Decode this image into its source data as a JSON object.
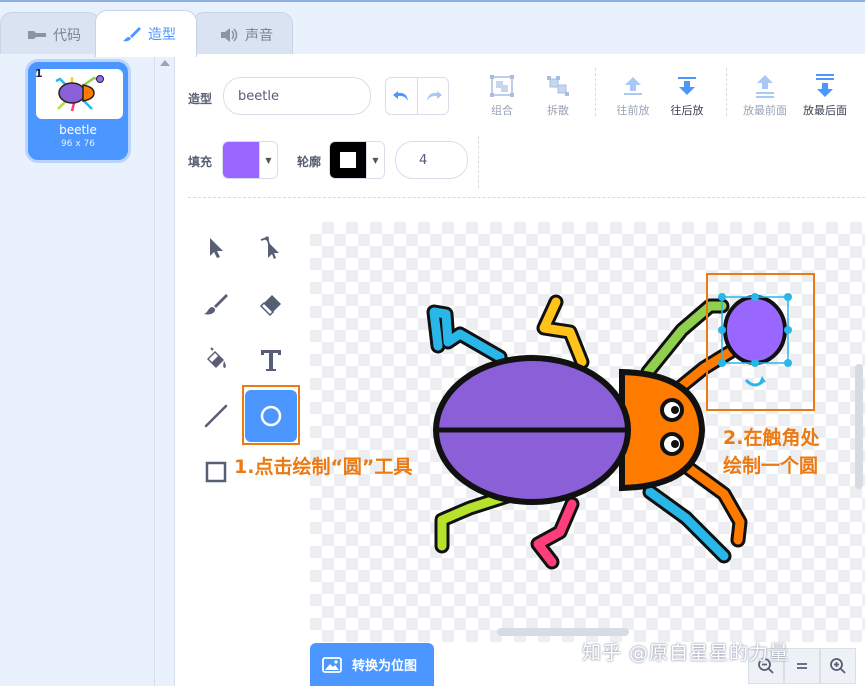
{
  "tabs": [
    {
      "label": "代码",
      "icon": "code-blocks-icon"
    },
    {
      "label": "造型",
      "icon": "brush-icon"
    },
    {
      "label": "声音",
      "icon": "speaker-icon"
    }
  ],
  "costume_list": [
    {
      "number": "1",
      "name": "beetle",
      "size": "96 x 76"
    }
  ],
  "toolbar": {
    "costume_label": "造型",
    "costume_name": "beetle",
    "group_label": "组合",
    "ungroup_label": "拆散",
    "forward_label": "往前放",
    "backward_label": "往后放",
    "front_label": "放最前面",
    "back_label": "放最后面",
    "fill_label": "填充",
    "outline_label": "轮廓",
    "outline_width": "4"
  },
  "colors": {
    "accent": "#4c97ff",
    "fill_color": "#9966ff",
    "outline_color": "#000000",
    "annotation": "#ec7a13",
    "beetle_body": "#8a5fd8",
    "beetle_head": "#ff7b00"
  },
  "tools": [
    "select-icon",
    "reshape-icon",
    "brush-icon",
    "eraser-icon",
    "fill-bucket-icon",
    "text-icon",
    "line-icon",
    "circle-icon",
    "rectangle-icon"
  ],
  "convert_button": "转换为位图",
  "annotations": {
    "step1": "1.点击绘制“圆”工具",
    "step2_line1": "2.在触角处",
    "step2_line2": "绘制一个圆"
  },
  "watermark": "知乎 @原自星星的力量"
}
